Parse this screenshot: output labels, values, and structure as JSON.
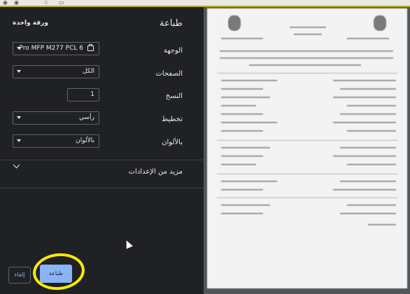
{
  "browser": {
    "icons": [
      "tab-icon",
      "tab-icon",
      "star-icon",
      "bookmark-icon"
    ]
  },
  "print": {
    "title": "طباعة",
    "sheets": "ورقة واحدة",
    "destination": {
      "label": "الوجهة",
      "value": "Pro MFP M277 PCL 6"
    },
    "pages": {
      "label": "الصفحات",
      "value": "الكل"
    },
    "copies": {
      "label": "النسخ",
      "value": "1"
    },
    "layout": {
      "label": "تخطيط",
      "value": "رأسي"
    },
    "color": {
      "label": "بالألوان",
      "value": "بالألوان"
    },
    "more_settings": "مزيد من الإعدادات",
    "print_button": "طباعة",
    "cancel_button": "إلغاء"
  },
  "colors": {
    "panel": "#202124",
    "accent": "#8ab4f8",
    "highlight": "#f5ec00"
  }
}
